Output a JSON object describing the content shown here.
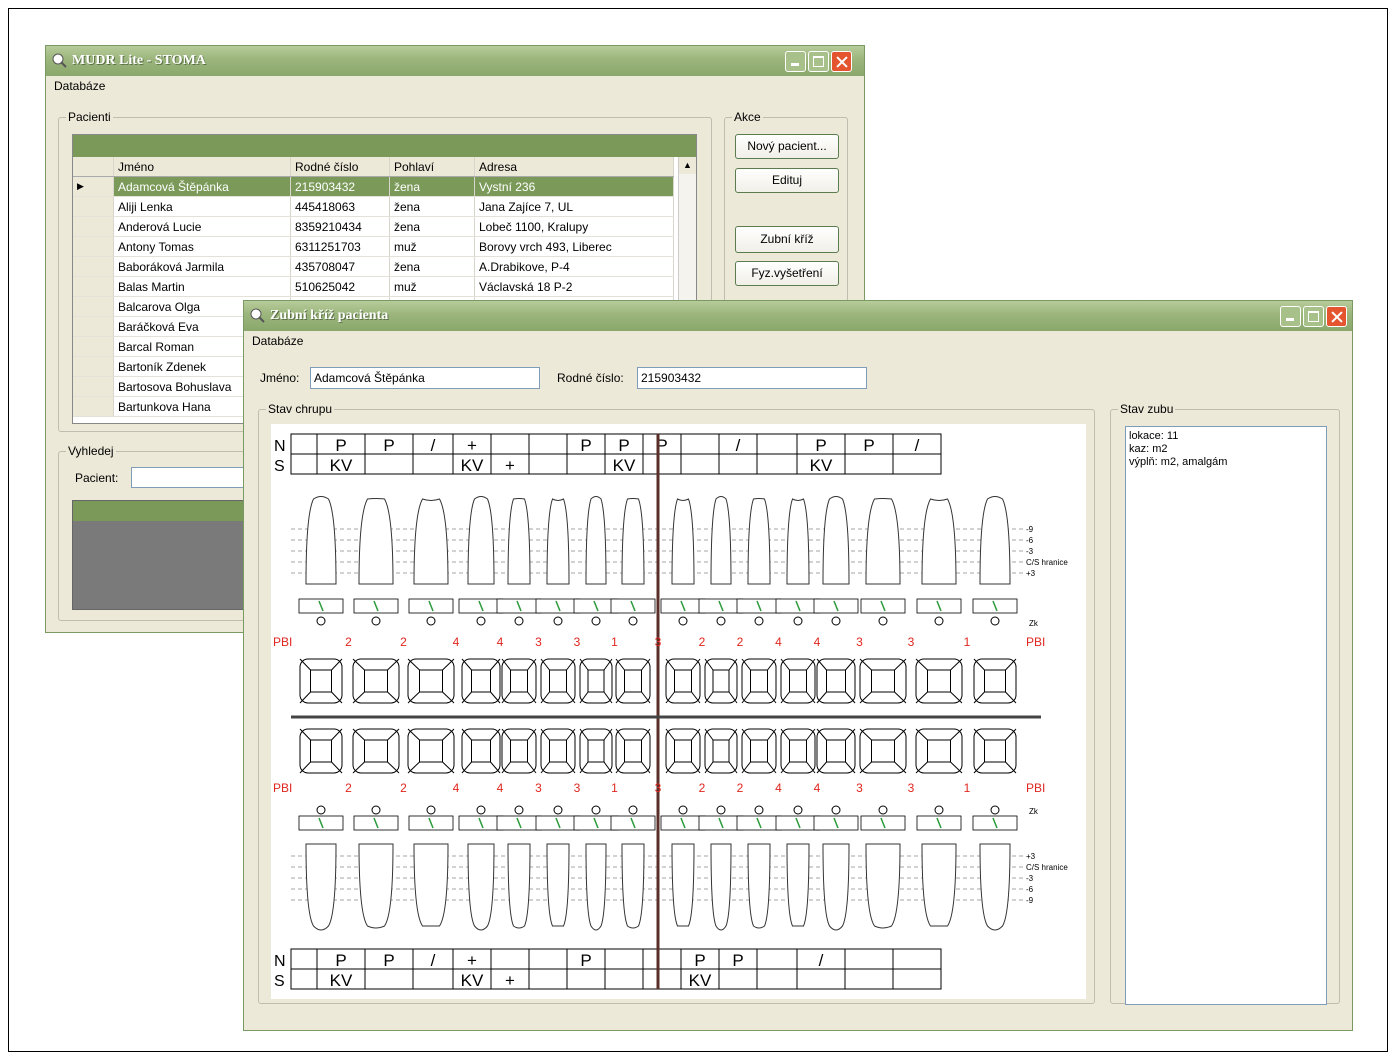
{
  "main_window": {
    "title": "MUDR Lite - STOMA",
    "menu": "Databáze",
    "patients_group": "Pacienti",
    "columns": [
      "Jméno",
      "Rodné číslo",
      "Pohlaví",
      "Adresa"
    ],
    "rows": [
      {
        "name": "Adamcová Štěpánka",
        "rc": "215903432",
        "sex": "žena",
        "addr": "Vystní 236"
      },
      {
        "name": "Aliji Lenka",
        "rc": "445418063",
        "sex": "žena",
        "addr": "Jana Zajíce 7, UL"
      },
      {
        "name": "Anderová Lucie",
        "rc": "8359210434",
        "sex": "žena",
        "addr": "Lobeč 1100, Kralupy"
      },
      {
        "name": "Antony Tomas",
        "rc": "6311251703",
        "sex": "muž",
        "addr": "Borovy vrch 493, Liberec"
      },
      {
        "name": "Baboráková Jarmila",
        "rc": "435708047",
        "sex": "žena",
        "addr": "A.Drabikove, P-4"
      },
      {
        "name": "Balas Martin",
        "rc": "510625042",
        "sex": "muž",
        "addr": "Václavská 18 P-2"
      },
      {
        "name": "Balcarova Olga",
        "rc": "",
        "sex": "",
        "addr": ""
      },
      {
        "name": "Baráčková Eva",
        "rc": "",
        "sex": "",
        "addr": ""
      },
      {
        "name": "Barcal Roman",
        "rc": "",
        "sex": "",
        "addr": ""
      },
      {
        "name": "Bartoník Zdenek",
        "rc": "",
        "sex": "",
        "addr": ""
      },
      {
        "name": "Bartosova Bohuslava",
        "rc": "",
        "sex": "",
        "addr": ""
      },
      {
        "name": "Bartunkova Hana",
        "rc": "",
        "sex": "",
        "addr": ""
      }
    ],
    "actions_group": "Akce",
    "actions": {
      "new_patient": "Nový pacient...",
      "edit": "Edituj",
      "dental_cross": "Zubní kříž",
      "physical_exam": "Fyz.vyšetření"
    },
    "search_group": "Vyhledej",
    "search_label": "Pacient:",
    "search_value": ""
  },
  "dental_window": {
    "title": "Zubní kříž pacienta",
    "menu": "Databáze",
    "name_label": "Jméno:",
    "name_value": "Adamcová Štěpánka",
    "rc_label": "Rodné číslo:",
    "rc_value": "215903432",
    "chart_group": "Stav chrupu",
    "tooth_group": "Stav zubu",
    "tooth_status": [
      "lokace: 11",
      "kaz: m2",
      "výplň: m2, amalgám"
    ],
    "chart": {
      "row_labels": [
        "N",
        "S"
      ],
      "upper_N": [
        "",
        "P",
        "P",
        "/",
        "+",
        "",
        "",
        "P",
        "P",
        "P",
        "",
        "/",
        "",
        "P",
        "P",
        "/"
      ],
      "upper_S": [
        "",
        "KV",
        "",
        "",
        "KV",
        "+",
        "",
        "",
        "KV",
        "",
        "",
        "",
        "",
        "KV",
        "",
        ""
      ],
      "lower_N": [
        "",
        "P",
        "P",
        "/",
        "+",
        "",
        "",
        "P",
        "",
        "",
        "P",
        "P",
        "",
        "/",
        "",
        ""
      ],
      "lower_S": [
        "",
        "KV",
        "",
        "",
        "KV",
        "+",
        "",
        "",
        "",
        "",
        "KV",
        "",
        "",
        "",
        "",
        ""
      ],
      "pbi_label": "PBI",
      "pbi_upper": [
        "2",
        "2",
        "4",
        "4",
        "3",
        "3",
        "1",
        "3",
        "2",
        "2",
        "4",
        "4",
        "3",
        "3",
        "1"
      ],
      "pbi_lower": [
        "2",
        "2",
        "4",
        "4",
        "3",
        "3",
        "1",
        "3",
        "2",
        "2",
        "4",
        "4",
        "3",
        "3",
        "1"
      ],
      "scale_upper": [
        "-9",
        "-6",
        "-3",
        "C/S hranice",
        "+3"
      ],
      "scale_lower": [
        "+3",
        "C/S hranice",
        "-3",
        "-6",
        "-9"
      ],
      "zk_label": "Zk"
    }
  },
  "colors": {
    "titlebar": "#9bb57c",
    "selection": "#7b9a59",
    "pbi_red": "#e0261f",
    "mobility_green": "#2a9a3a",
    "midline": "#5a2f2a"
  }
}
